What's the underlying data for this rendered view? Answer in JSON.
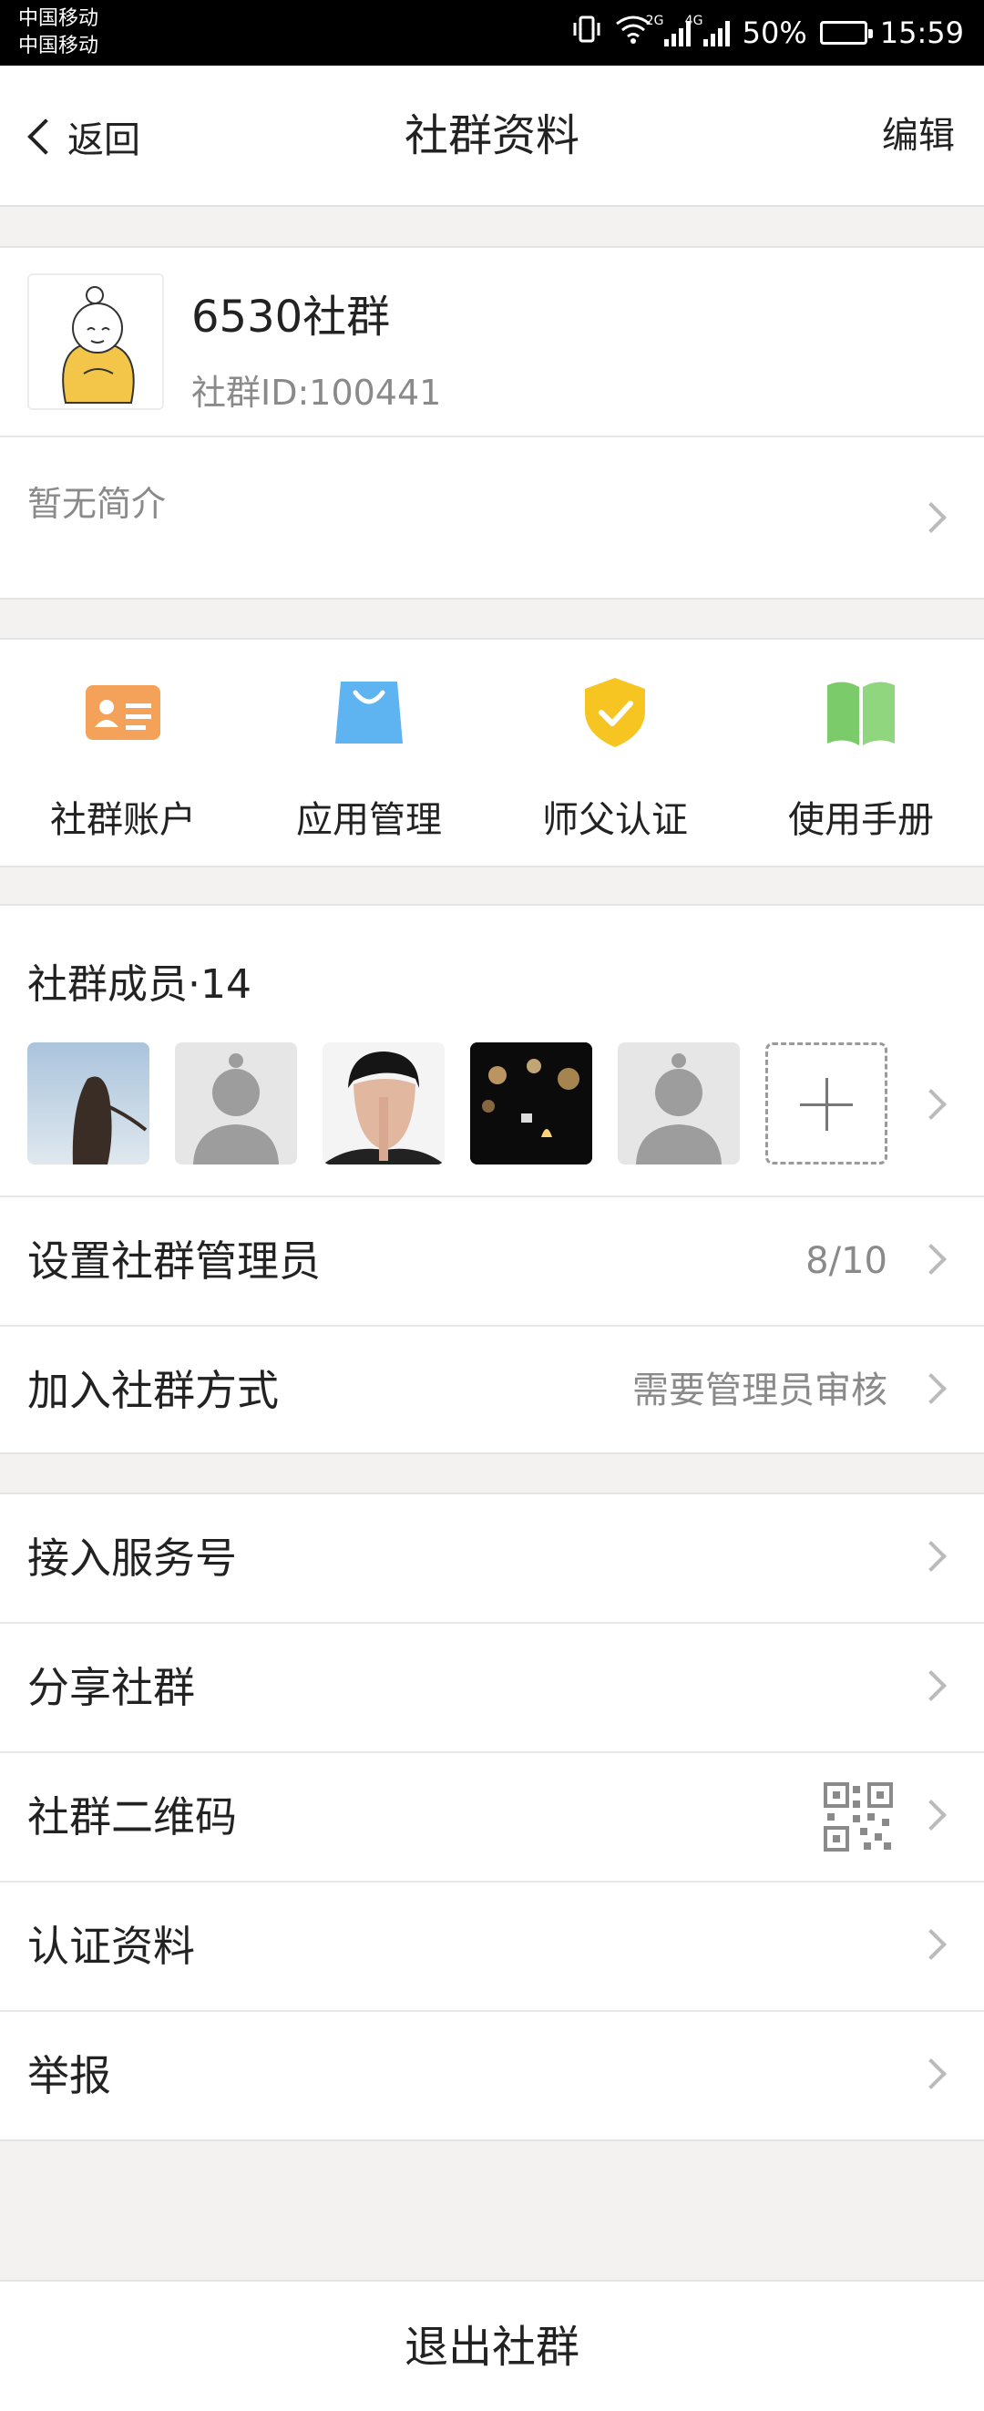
{
  "status_bar": {
    "carrier_1": "中国移动",
    "carrier_2": "中国移动",
    "net_1": "2G",
    "net_2": "4G",
    "battery": "50%",
    "time": "15:59"
  },
  "nav": {
    "back_label": "返回",
    "title": "社群资料",
    "edit_label": "编辑"
  },
  "profile": {
    "name": "6530社群",
    "id_text": "社群ID:100441",
    "intro": "暂无简介"
  },
  "features": [
    {
      "label": "社群账户",
      "icon": "id-card-icon",
      "color": "#f4a25a"
    },
    {
      "label": "应用管理",
      "icon": "shopping-bag-icon",
      "color": "#5eb4f0"
    },
    {
      "label": "师父认证",
      "icon": "shield-check-icon",
      "color": "#f6c521"
    },
    {
      "label": "使用手册",
      "icon": "book-icon",
      "color": "#7ccb6a"
    }
  ],
  "members": {
    "title": "社群成员·14"
  },
  "admin_rows": [
    {
      "label": "设置社群管理员",
      "value": "8/10"
    },
    {
      "label": "加入社群方式",
      "value": "需要管理员审核"
    }
  ],
  "menu_rows": [
    {
      "label": "接入服务号"
    },
    {
      "label": "分享社群"
    },
    {
      "label": "社群二维码"
    },
    {
      "label": "认证资料"
    },
    {
      "label": "举报"
    }
  ],
  "exit_label": "退出社群"
}
